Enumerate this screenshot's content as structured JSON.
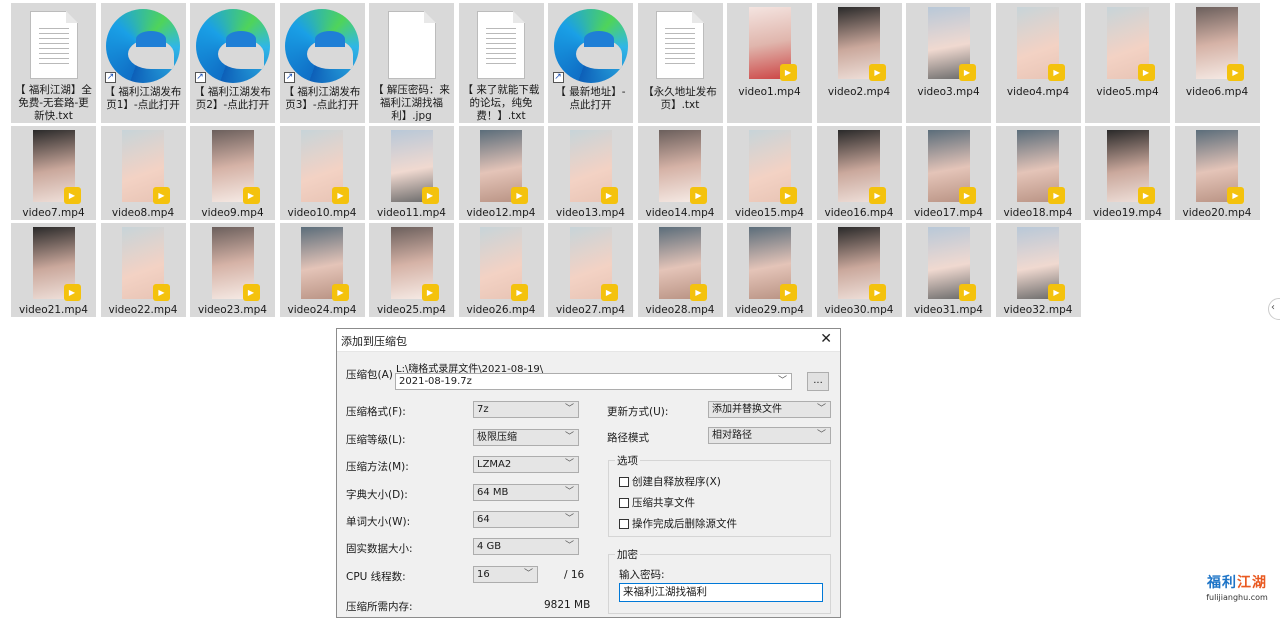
{
  "explorer": {
    "items": [
      {
        "name": "【 福利江湖】全免费-无套路-更新快.txt",
        "kind": "txt"
      },
      {
        "name": "【 福利江湖发布页1】-点此打开",
        "kind": "edge"
      },
      {
        "name": "【 福利江湖发布页2】-点此打开",
        "kind": "edge"
      },
      {
        "name": "【 福利江湖发布页3】-点此打开",
        "kind": "edge"
      },
      {
        "name": "【 解压密码：来福利江湖找福利】.jpg",
        "kind": "jpg"
      },
      {
        "name": "【 来了就能下载的论坛，纯免费！】.txt",
        "kind": "txt"
      },
      {
        "name": "【 最新地址】-点此打开",
        "kind": "edge"
      },
      {
        "name": "【永久地址发布页】.txt",
        "kind": "txt"
      },
      {
        "name": "video1.mp4",
        "kind": "video",
        "tone": "t1"
      },
      {
        "name": "video2.mp4",
        "kind": "video",
        "tone": "t2"
      },
      {
        "name": "video3.mp4",
        "kind": "video",
        "tone": "t3"
      },
      {
        "name": "video4.mp4",
        "kind": "video",
        "tone": "t4"
      },
      {
        "name": "video5.mp4",
        "kind": "video",
        "tone": "t4"
      },
      {
        "name": "video6.mp4",
        "kind": "video",
        "tone": "t5"
      },
      {
        "name": "video7.mp4",
        "kind": "video",
        "tone": "t2"
      },
      {
        "name": "video8.mp4",
        "kind": "video",
        "tone": "t4"
      },
      {
        "name": "video9.mp4",
        "kind": "video",
        "tone": "t5"
      },
      {
        "name": "video10.mp4",
        "kind": "video",
        "tone": "t4"
      },
      {
        "name": "video11.mp4",
        "kind": "video",
        "tone": "t3"
      },
      {
        "name": "video12.mp4",
        "kind": "video",
        "tone": "t6"
      },
      {
        "name": "video13.mp4",
        "kind": "video",
        "tone": "t4"
      },
      {
        "name": "video14.mp4",
        "kind": "video",
        "tone": "t5"
      },
      {
        "name": "video15.mp4",
        "kind": "video",
        "tone": "t4"
      },
      {
        "name": "video16.mp4",
        "kind": "video",
        "tone": "t2"
      },
      {
        "name": "video17.mp4",
        "kind": "video",
        "tone": "t6"
      },
      {
        "name": "video18.mp4",
        "kind": "video",
        "tone": "t6"
      },
      {
        "name": "video19.mp4",
        "kind": "video",
        "tone": "t2"
      },
      {
        "name": "video20.mp4",
        "kind": "video",
        "tone": "t6"
      },
      {
        "name": "video21.mp4",
        "kind": "video",
        "tone": "t2"
      },
      {
        "name": "video22.mp4",
        "kind": "video",
        "tone": "t4"
      },
      {
        "name": "video23.mp4",
        "kind": "video",
        "tone": "t5"
      },
      {
        "name": "video24.mp4",
        "kind": "video",
        "tone": "t6"
      },
      {
        "name": "video25.mp4",
        "kind": "video",
        "tone": "t5"
      },
      {
        "name": "video26.mp4",
        "kind": "video",
        "tone": "t4"
      },
      {
        "name": "video27.mp4",
        "kind": "video",
        "tone": "t4"
      },
      {
        "name": "video28.mp4",
        "kind": "video",
        "tone": "t6"
      },
      {
        "name": "video29.mp4",
        "kind": "video",
        "tone": "t6"
      },
      {
        "name": "video30.mp4",
        "kind": "video",
        "tone": "t2"
      },
      {
        "name": "video31.mp4",
        "kind": "video",
        "tone": "t3"
      },
      {
        "name": "video32.mp4",
        "kind": "video",
        "tone": "t3"
      }
    ]
  },
  "dialog": {
    "title": "添加到压缩包",
    "archive_label": "压缩包(A)",
    "archive_path": "L:\\嗨格式录屏文件\\2021-08-19\\",
    "archive_name": "2021-08-19.7z",
    "browse_label": "...",
    "format_label": "压缩格式(F):",
    "format_value": "7z",
    "level_label": "压缩等级(L):",
    "level_value": "极限压缩",
    "method_label": "压缩方法(M):",
    "method_value": "LZMA2",
    "dict_label": "字典大小(D):",
    "dict_value": "64 MB",
    "word_label": "单词大小(W):",
    "word_value": "64",
    "solid_label": "固实数据大小:",
    "solid_value": "4 GB",
    "threads_label": "CPU 线程数:",
    "threads_value": "16",
    "threads_total": "/ 16",
    "memory_label": "压缩所需内存:",
    "memory_value": "9821 MB",
    "update_label": "更新方式(U):",
    "update_value": "添加并替换文件",
    "path_label": "路径模式",
    "path_value": "相对路径",
    "options_title": "选项",
    "opt_sfx": "创建自释放程序(X)",
    "opt_shared": "压缩共享文件",
    "opt_delete": "操作完成后删除源文件",
    "encrypt_title": "加密",
    "password_label": "输入密码:",
    "password_value": "来福利江湖找福利"
  },
  "watermark": {
    "brand_a": "福利",
    "brand_b": "江湖",
    "domain": "fulijianghu.com"
  }
}
